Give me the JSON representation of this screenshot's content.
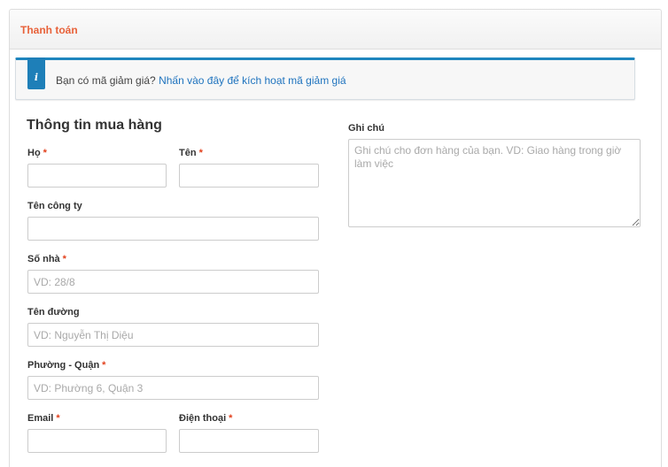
{
  "panel": {
    "title": "Thanh toán"
  },
  "coupon": {
    "icon": "info-icon",
    "text": "Bạn có mã giảm giá?",
    "link": "Nhấn vào đây để kích hoạt mã giảm giá"
  },
  "billing": {
    "title": "Thông tin mua hàng",
    "required_mark": "*",
    "last_name": {
      "label": "Họ",
      "value": "",
      "placeholder": ""
    },
    "first_name": {
      "label": "Tên",
      "value": "",
      "placeholder": ""
    },
    "company": {
      "label": "Tên công ty",
      "value": "",
      "placeholder": ""
    },
    "house_number": {
      "label": "Số nhà",
      "value": "",
      "placeholder": "VD: 28/8"
    },
    "street": {
      "label": "Tên đường",
      "value": "",
      "placeholder": "VD: Nguyễn Thị Diệu"
    },
    "ward_district": {
      "label": "Phường - Quận",
      "value": "",
      "placeholder": "VD: Phường 6, Quận 3"
    },
    "email": {
      "label": "Email",
      "value": "",
      "placeholder": ""
    },
    "phone": {
      "label": "Điện thoại",
      "value": "",
      "placeholder": ""
    }
  },
  "notes": {
    "label": "Ghi chú",
    "placeholder": "Ghi chú cho đơn hàng của bạn. VD: Giao hàng trong giờ làm việc"
  },
  "colors": {
    "accent": "#e8623a",
    "info": "#1e85be",
    "required": "#e2401c",
    "link": "#1e73be"
  }
}
